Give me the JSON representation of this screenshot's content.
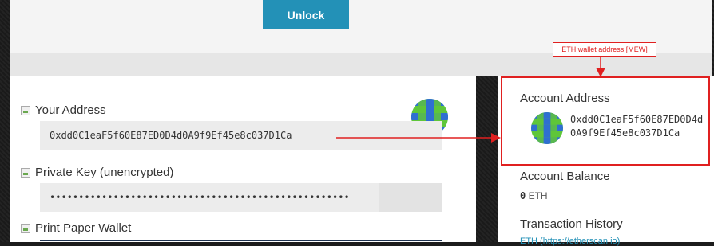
{
  "unlock_button": {
    "label": "Unlock"
  },
  "wallet": {
    "your_address": {
      "label": "Your Address",
      "value": "0xdd0C1eaF5f60E87ED0D4d0A9f9Ef45e8c037D1Ca"
    },
    "private_key": {
      "label": "Private Key (unencrypted)",
      "value": "••••••••••••••••••••••••••••••••••••••••••••••••••••"
    },
    "print_paper_wallet": {
      "label": "Print Paper Wallet"
    }
  },
  "account": {
    "address_heading": "Account Address",
    "address_value": "0xdd0C1eaF5f60E87ED0D4d0A9f9Ef45e8c037D1Ca",
    "balance_heading": "Account Balance",
    "balance_amount": "0",
    "balance_unit": "ETH",
    "history_heading": "Transaction History",
    "history_sub": "ETH (https://etherscan.io)"
  },
  "annotation": {
    "callout_text": "ETH wallet address [MEW]",
    "color": "#e02020"
  },
  "colors": {
    "accent": "#2391b7",
    "identicon_blue": "#2f6fd1",
    "identicon_green": "#5fc63a"
  }
}
